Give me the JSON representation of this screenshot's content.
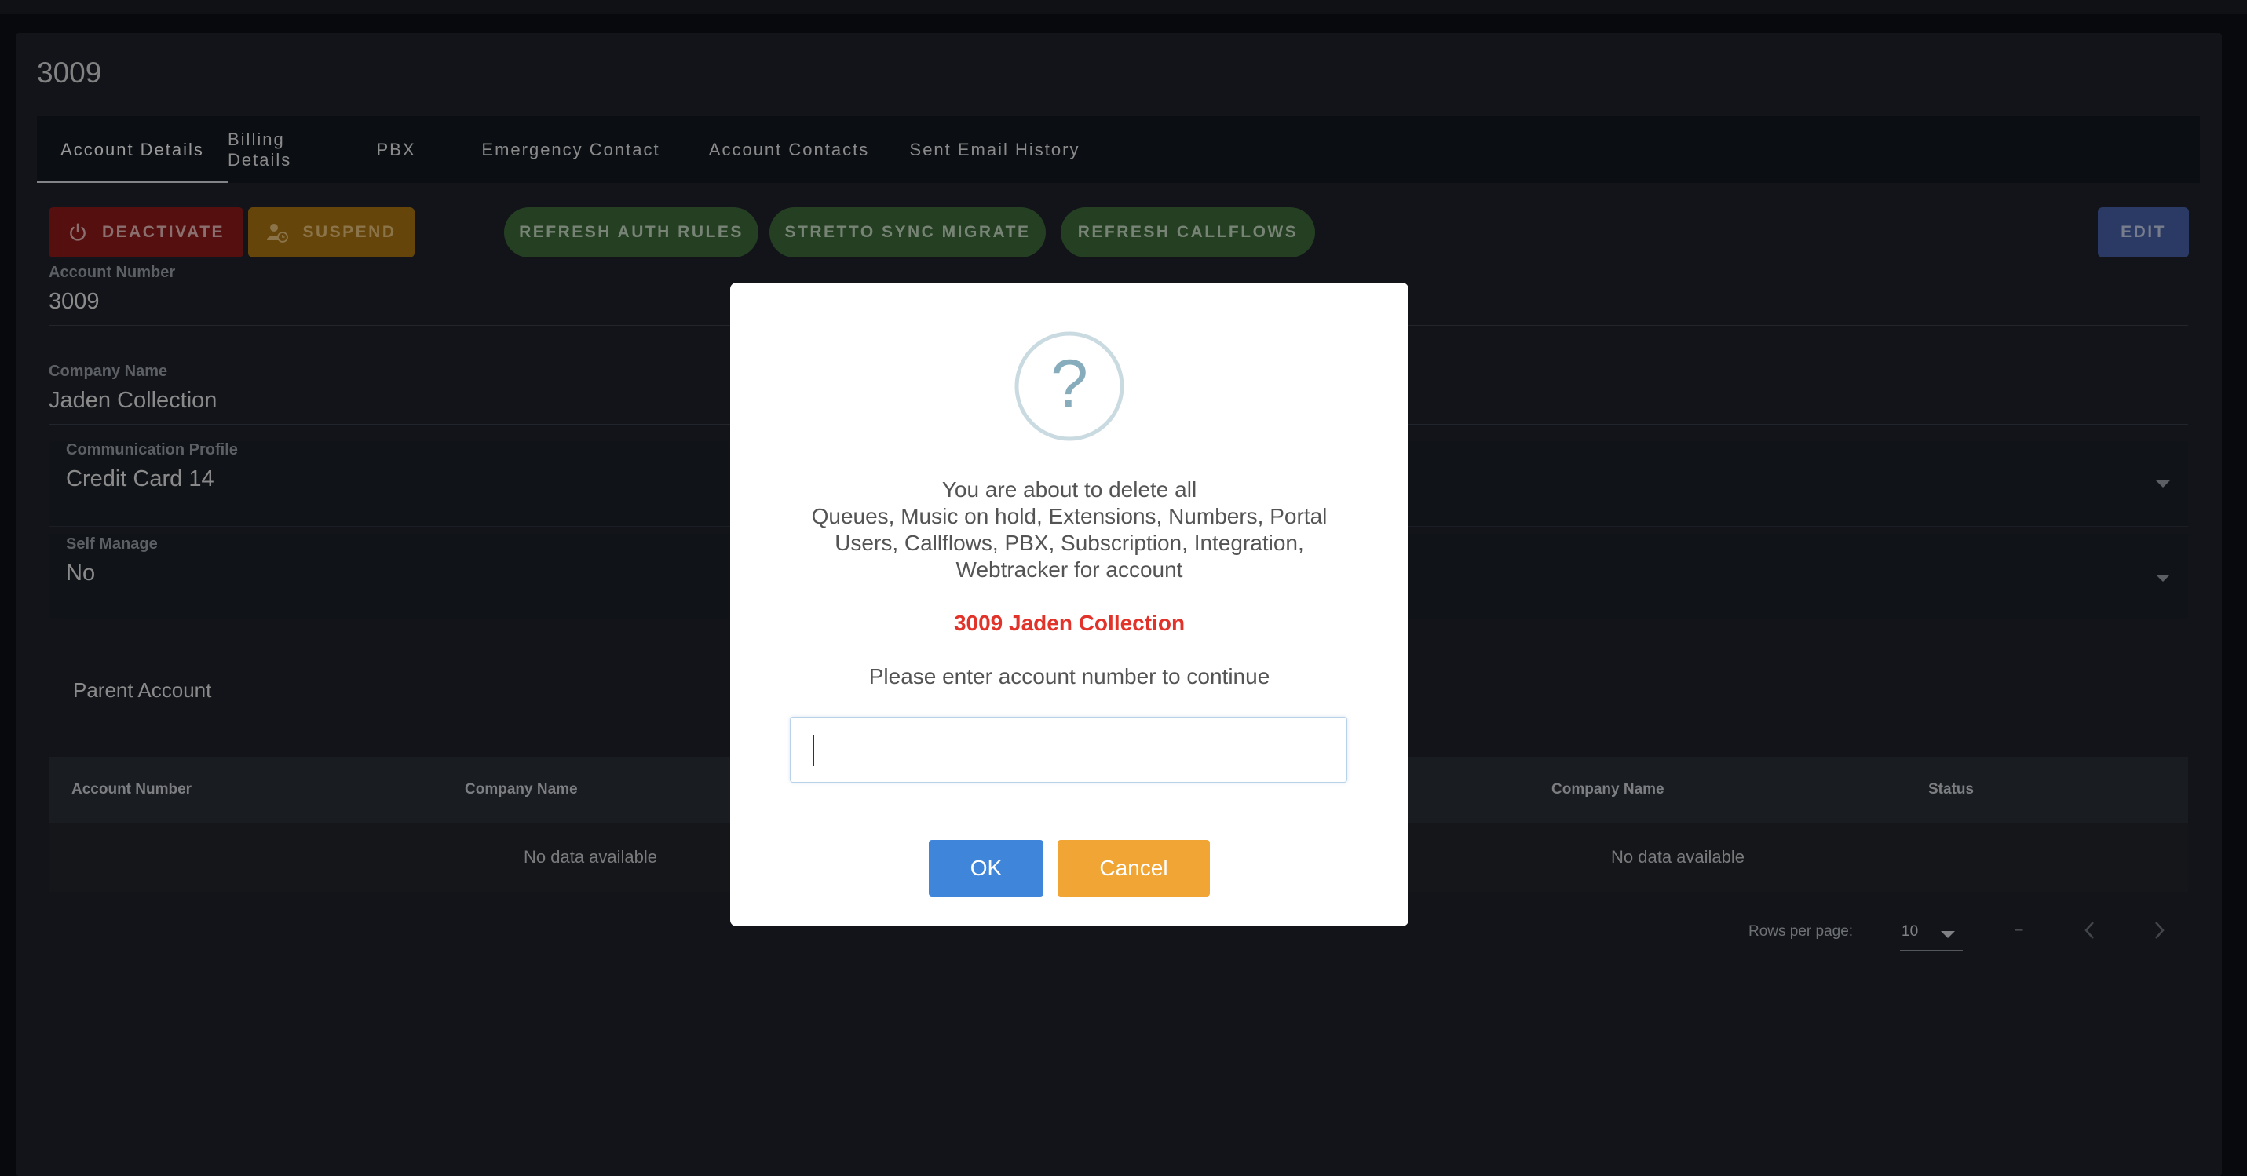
{
  "page": {
    "title": "3009"
  },
  "tabs": [
    {
      "label": "Account Details",
      "active": true
    },
    {
      "label": "Billing Details"
    },
    {
      "label": "PBX"
    },
    {
      "label": "Emergency Contact"
    },
    {
      "label": "Account Contacts"
    },
    {
      "label": "Sent Email History"
    }
  ],
  "actions": {
    "deactivate": "DEACTIVATE",
    "suspend": "SUSPEND",
    "refresh_auth_rules": "REFRESH AUTH RULES",
    "stretto_sync_migrate": "STRETTO SYNC MIGRATE",
    "refresh_callflows": "REFRESH CALLFLOWS",
    "edit": "EDIT"
  },
  "fields": {
    "account_number": {
      "label": "Account Number",
      "value": "3009"
    },
    "company_name": {
      "label": "Company Name",
      "value": "Jaden Collection"
    },
    "communication_profile": {
      "label": "Communication Profile",
      "value": "Credit Card 14"
    },
    "self_manage": {
      "label": "Self Manage",
      "value": "No"
    }
  },
  "parent_account": {
    "title": "Parent Account",
    "left_table": {
      "headers": [
        "Account Number",
        "Company Name"
      ],
      "empty_text": "No data available"
    },
    "right_table": {
      "headers": [
        "Company Name",
        "Status"
      ],
      "empty_text": "No data available"
    },
    "pagination": {
      "rows_per_page_label": "Rows per page:",
      "rows_per_page": "10",
      "range": "–"
    }
  },
  "modal": {
    "icon": "question-icon",
    "message_lines": [
      "You are about to delete all",
      "Queues, Music on hold, Extensions, Numbers, Portal",
      "Users, Callflows, PBX, Subscription, Integration,",
      "Webtracker for account"
    ],
    "account_text": "3009 Jaden Collection",
    "prompt": "Please enter account number to continue",
    "input_value": "",
    "ok_label": "OK",
    "cancel_label": "Cancel"
  },
  "colors": {
    "deactivate": "#8e1a1a",
    "suspend": "#a87412",
    "green_action": "#3f6a3a",
    "edit": "#4761a8",
    "ok": "#3f85d9",
    "cancel": "#f0a534",
    "account_highlight": "#e2332a"
  }
}
